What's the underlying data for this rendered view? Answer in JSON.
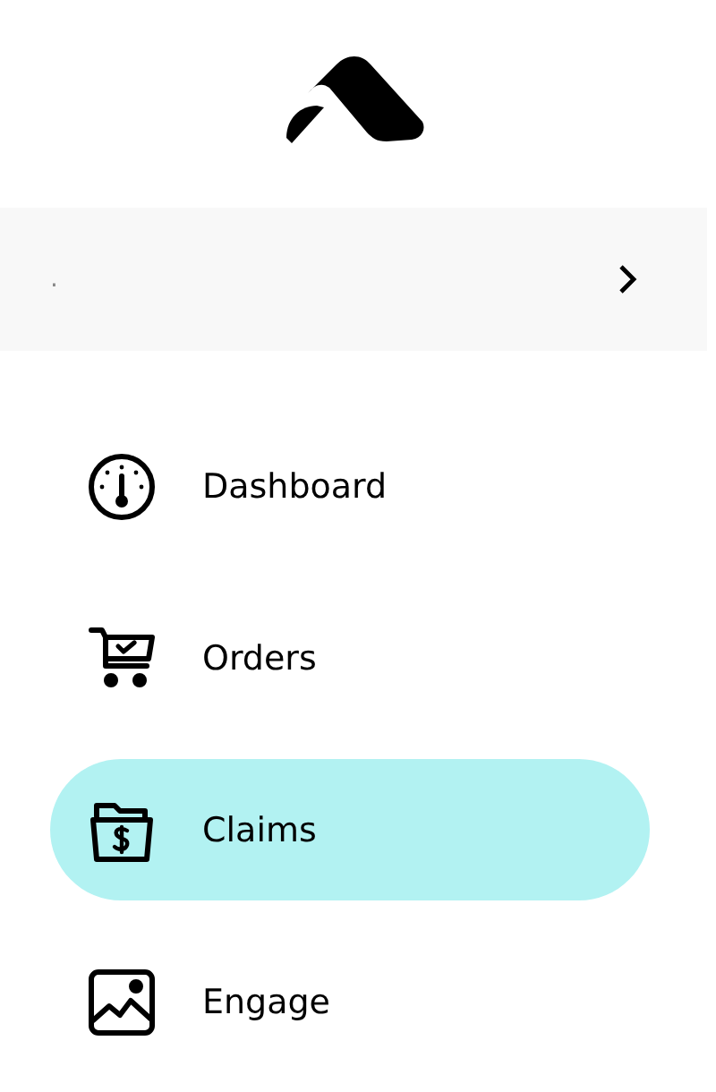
{
  "account": {
    "name": "."
  },
  "nav": [
    {
      "label": "Dashboard",
      "selected": false
    },
    {
      "label": "Orders",
      "selected": false
    },
    {
      "label": "Claims",
      "selected": true
    },
    {
      "label": "Engage",
      "selected": false
    }
  ]
}
